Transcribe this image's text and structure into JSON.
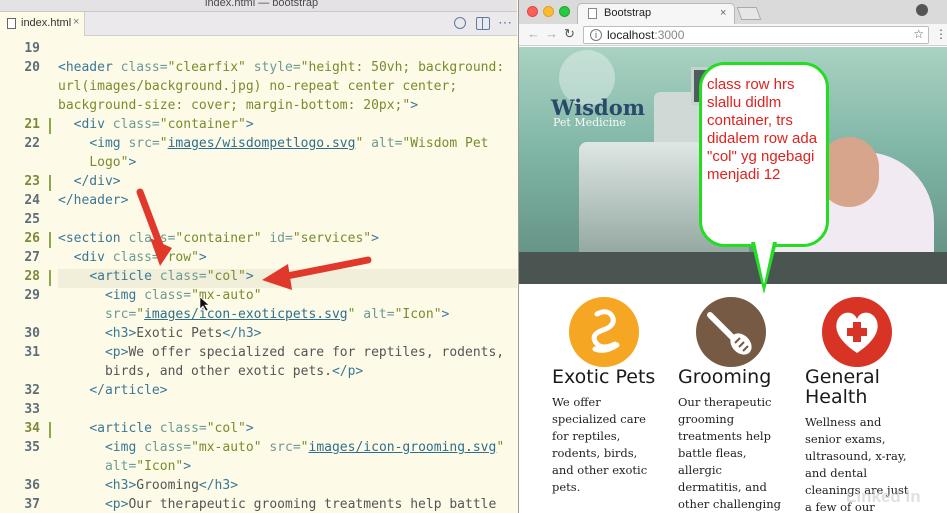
{
  "editor": {
    "window_title": "index.html — bootstrap",
    "tab_label": "index.html",
    "tab_close": "×",
    "lines": [
      {
        "n": "19",
        "html": ""
      },
      {
        "n": "20",
        "html": "<span class='tg'>&lt;header</span> <span class='at'>class=</span><span class='st'>\"clearfix\"</span> <span class='at'>style=</span><span class='st'>\"height: 50vh; background:</span>"
      },
      {
        "n": "",
        "html": "<span class='st'>url(images/background.jpg) no-repeat center center;</span>"
      },
      {
        "n": "",
        "html": "<span class='st'>background-size: cover; margin-bottom: 20px;\"</span><span class='tg'>&gt;</span>"
      },
      {
        "n": "21",
        "html": "  <span class='tg'>&lt;div</span> <span class='at'>class=</span><span class='st'>\"container\"</span><span class='tg'>&gt;</span>"
      },
      {
        "n": "22",
        "html": "    <span class='tg'>&lt;img</span> <span class='at'>src=</span><span class='st'>\"<span class='ul'>images/wisdompetlogo.svg</span>\"</span> <span class='at'>alt=</span><span class='st'>\"Wisdom Pet</span>"
      },
      {
        "n": "",
        "html": "    <span class='st'>Logo\"</span><span class='tg'>&gt;</span>"
      },
      {
        "n": "23",
        "html": "  <span class='tg'>&lt;/div&gt;</span>"
      },
      {
        "n": "24",
        "html": "<span class='tg'>&lt;/header&gt;</span>"
      },
      {
        "n": "25",
        "html": ""
      },
      {
        "n": "26",
        "html": "<span class='tg'>&lt;section</span> <span class='at'>class=</span><span class='st'>\"container\"</span> <span class='at'>id=</span><span class='st'>\"services\"</span><span class='tg'>&gt;</span>"
      },
      {
        "n": "27",
        "html": "  <span class='tg'>&lt;div</span> <span class='at'>class=</span><span class='st'>\"row\"</span><span class='tg'>&gt;</span>"
      },
      {
        "n": "28",
        "html": "    <span class='tg'>&lt;article</span> <span class='at'>class=</span><span class='st'>\"col\"</span><span class='tg'>&gt;</span>"
      },
      {
        "n": "29",
        "html": "      <span class='tg'>&lt;img</span> <span class='at'>class=</span><span class='st'>\"mx-auto\"</span>"
      },
      {
        "n": "",
        "html": "      <span class='at'>src=</span><span class='st'>\"<span class='ul'>images/icon-exoticpets.svg</span>\"</span> <span class='at'>alt=</span><span class='st'>\"Icon\"</span><span class='tg'>&gt;</span>"
      },
      {
        "n": "30",
        "html": "      <span class='tg'>&lt;h3&gt;</span><span class='tx'>Exotic Pets</span><span class='tg'>&lt;/h3&gt;</span>"
      },
      {
        "n": "31",
        "html": "      <span class='tg'>&lt;p&gt;</span><span class='tx'>We offer specialized care for reptiles, rodents,</span>"
      },
      {
        "n": "",
        "html": "      <span class='tx'>birds, and other exotic pets.</span><span class='tg'>&lt;/p&gt;</span>"
      },
      {
        "n": "32",
        "html": "    <span class='tg'>&lt;/article&gt;</span>"
      },
      {
        "n": "33",
        "html": ""
      },
      {
        "n": "34",
        "html": "    <span class='tg'>&lt;article</span> <span class='at'>class=</span><span class='st'>\"col\"</span><span class='tg'>&gt;</span>"
      },
      {
        "n": "35",
        "html": "      <span class='tg'>&lt;img</span> <span class='at'>class=</span><span class='st'>\"mx-auto\"</span> <span class='at'>src=</span><span class='st'>\"<span class='ul'>images/icon-grooming.svg</span>\"</span>"
      },
      {
        "n": "",
        "html": "      <span class='at'>alt=</span><span class='st'>\"Icon\"</span><span class='tg'>&gt;</span>"
      },
      {
        "n": "36",
        "html": "      <span class='tg'>&lt;h3&gt;</span><span class='tx'>Grooming</span><span class='tg'>&lt;/h3&gt;</span>"
      },
      {
        "n": "37",
        "html": "      <span class='tg'>&lt;p&gt;</span><span class='tx'>Our therapeutic grooming treatments help battle</span>"
      }
    ],
    "modified_lines": [
      "21",
      "23",
      "26",
      "28",
      "34"
    ]
  },
  "browser": {
    "tab_title": "Bootstrap",
    "tab_close": "×",
    "url_host": "localhost",
    "url_port": ":3000",
    "nav_back": "←",
    "nav_forward": "→",
    "nav_reload": "↻",
    "star": "☆",
    "menu": "⋮",
    "info": "i"
  },
  "page": {
    "logo_word": "Wisdom",
    "logo_sub": "Pet Medicine",
    "callout": "class row hrs slallu didlm container, trs didalem row ada \"col\" yg ngebagi menjadi 12",
    "services": [
      {
        "title": "Exotic Pets",
        "text": "We offer specialized care for reptiles, rodents, birds, and other exotic pets."
      },
      {
        "title": "Grooming",
        "text": "Our therapeutic grooming treatments help battle fleas, allergic dermatitis, and other challenging skin"
      },
      {
        "title": "General Health",
        "text": "Wellness and senior exams, ultrasound, x-ray, and dental cleanings are just a few of our general"
      }
    ]
  },
  "watermark": "Linked in",
  "colors": {
    "arrow": "#e0392b",
    "callout_border": "#22dd22",
    "callout_text": "#e0221e",
    "exotic_icon": "#f5a623",
    "grooming_icon": "#775a43",
    "health_icon": "#d83426"
  }
}
